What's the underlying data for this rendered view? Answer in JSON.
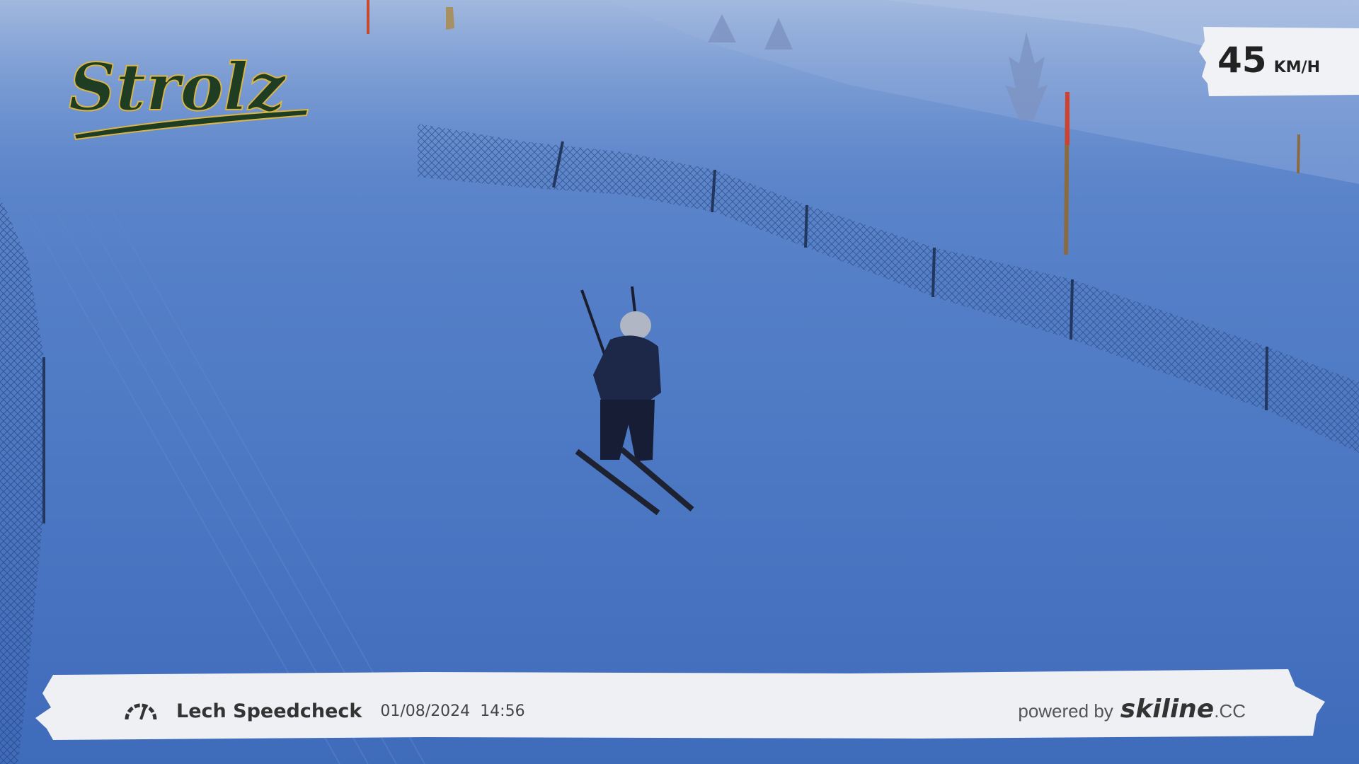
{
  "brand": {
    "logo_text": "Strolz",
    "logo_color": "#1f3d22",
    "logo_outline": "#d8b548"
  },
  "speed": {
    "value": "45",
    "unit": "KM/H"
  },
  "footer": {
    "icon": "gauge-icon",
    "title": "Lech Speedcheck",
    "date": "01/08/2024",
    "time": "14:56",
    "powered_label": "powered by",
    "powered_brand": "skiline",
    "powered_tld": ".CC"
  },
  "colors": {
    "sky_snow": "#4a74c0",
    "banner": "#eef0f4",
    "speed_box": "#f0f2f6"
  }
}
